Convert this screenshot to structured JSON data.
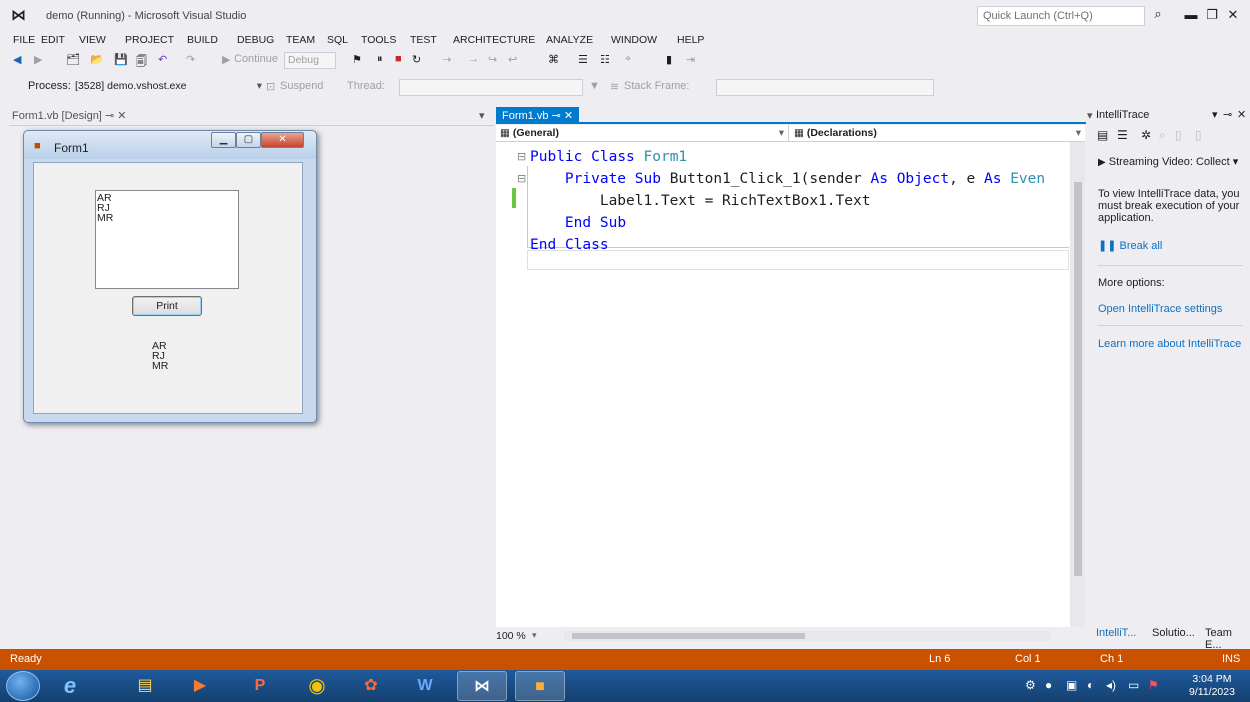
{
  "window": {
    "title": "demo (Running) - Microsoft Visual Studio",
    "quick_launch_placeholder": "Quick Launch (Ctrl+Q)"
  },
  "menu": [
    "FILE",
    "EDIT",
    "VIEW",
    "PROJECT",
    "BUILD",
    "DEBUG",
    "TEAM",
    "SQL",
    "TOOLS",
    "TEST",
    "ARCHITECTURE",
    "ANALYZE",
    "WINDOW",
    "HELP"
  ],
  "toolbar": {
    "continue_label": "Continue",
    "config_value": "Debug",
    "process_label": "Process:",
    "process_value": "[3528] demo.vshost.exe",
    "suspend_label": "Suspend",
    "thread_label": "Thread:",
    "stack_frame_label": "Stack Frame:"
  },
  "designer": {
    "tab_label": "Form1.vb [Design]",
    "form_title": "Form1",
    "richtextbox_lines": [
      "AR",
      "RJ",
      "MR"
    ],
    "print_button": "Print",
    "label_lines": [
      "AR",
      "RJ",
      "MR"
    ]
  },
  "editor": {
    "tab_label": "Form1.vb",
    "nav_left": "(General)",
    "nav_right": "(Declarations)",
    "zoom": "100 %",
    "code": [
      {
        "parts": [
          {
            "t": "Public",
            "c": "kw"
          },
          {
            "t": " "
          },
          {
            "t": "Class",
            "c": "kw"
          },
          {
            "t": " "
          },
          {
            "t": "Form1",
            "c": "ty"
          }
        ]
      },
      {
        "parts": [
          {
            "t": "    "
          },
          {
            "t": "Private",
            "c": "kw"
          },
          {
            "t": " "
          },
          {
            "t": "Sub",
            "c": "kw"
          },
          {
            "t": " Button1_Click_1(sender "
          },
          {
            "t": "As",
            "c": "kw"
          },
          {
            "t": " "
          },
          {
            "t": "Object",
            "c": "kw"
          },
          {
            "t": ", e "
          },
          {
            "t": "As",
            "c": "kw"
          },
          {
            "t": " "
          },
          {
            "t": "Even",
            "c": "ty"
          }
        ]
      },
      {
        "parts": [
          {
            "t": "        Label1.Text = RichTextBox1.Text"
          }
        ]
      },
      {
        "parts": [
          {
            "t": "    "
          },
          {
            "t": "End",
            "c": "kw"
          },
          {
            "t": " "
          },
          {
            "t": "Sub",
            "c": "kw"
          }
        ]
      },
      {
        "parts": [
          {
            "t": "End",
            "c": "kw"
          },
          {
            "t": " "
          },
          {
            "t": "Class",
            "c": "kw"
          }
        ]
      }
    ]
  },
  "intellitrace": {
    "title": "IntelliTrace",
    "streaming_video": "Streaming Video: Collect",
    "info_text": "To view IntelliTrace data, you must break execution of your application.",
    "break_all": "Break all",
    "more_options": "More options:",
    "open_settings": "Open IntelliTrace settings",
    "learn_more": "Learn more about IntelliTrace",
    "tabs": [
      "IntelliT...",
      "Solutio...",
      "Team E..."
    ]
  },
  "status": {
    "ready": "Ready",
    "ln": "Ln 6",
    "col": "Col 1",
    "ch": "Ch 1",
    "ins": "INS"
  },
  "clock": {
    "time": "3:04 PM",
    "date": "9/11/2023"
  },
  "colors": {
    "status_bar": "#ca5100",
    "accent": "#007acc",
    "keyword": "#0000ff",
    "type": "#2b91af"
  }
}
